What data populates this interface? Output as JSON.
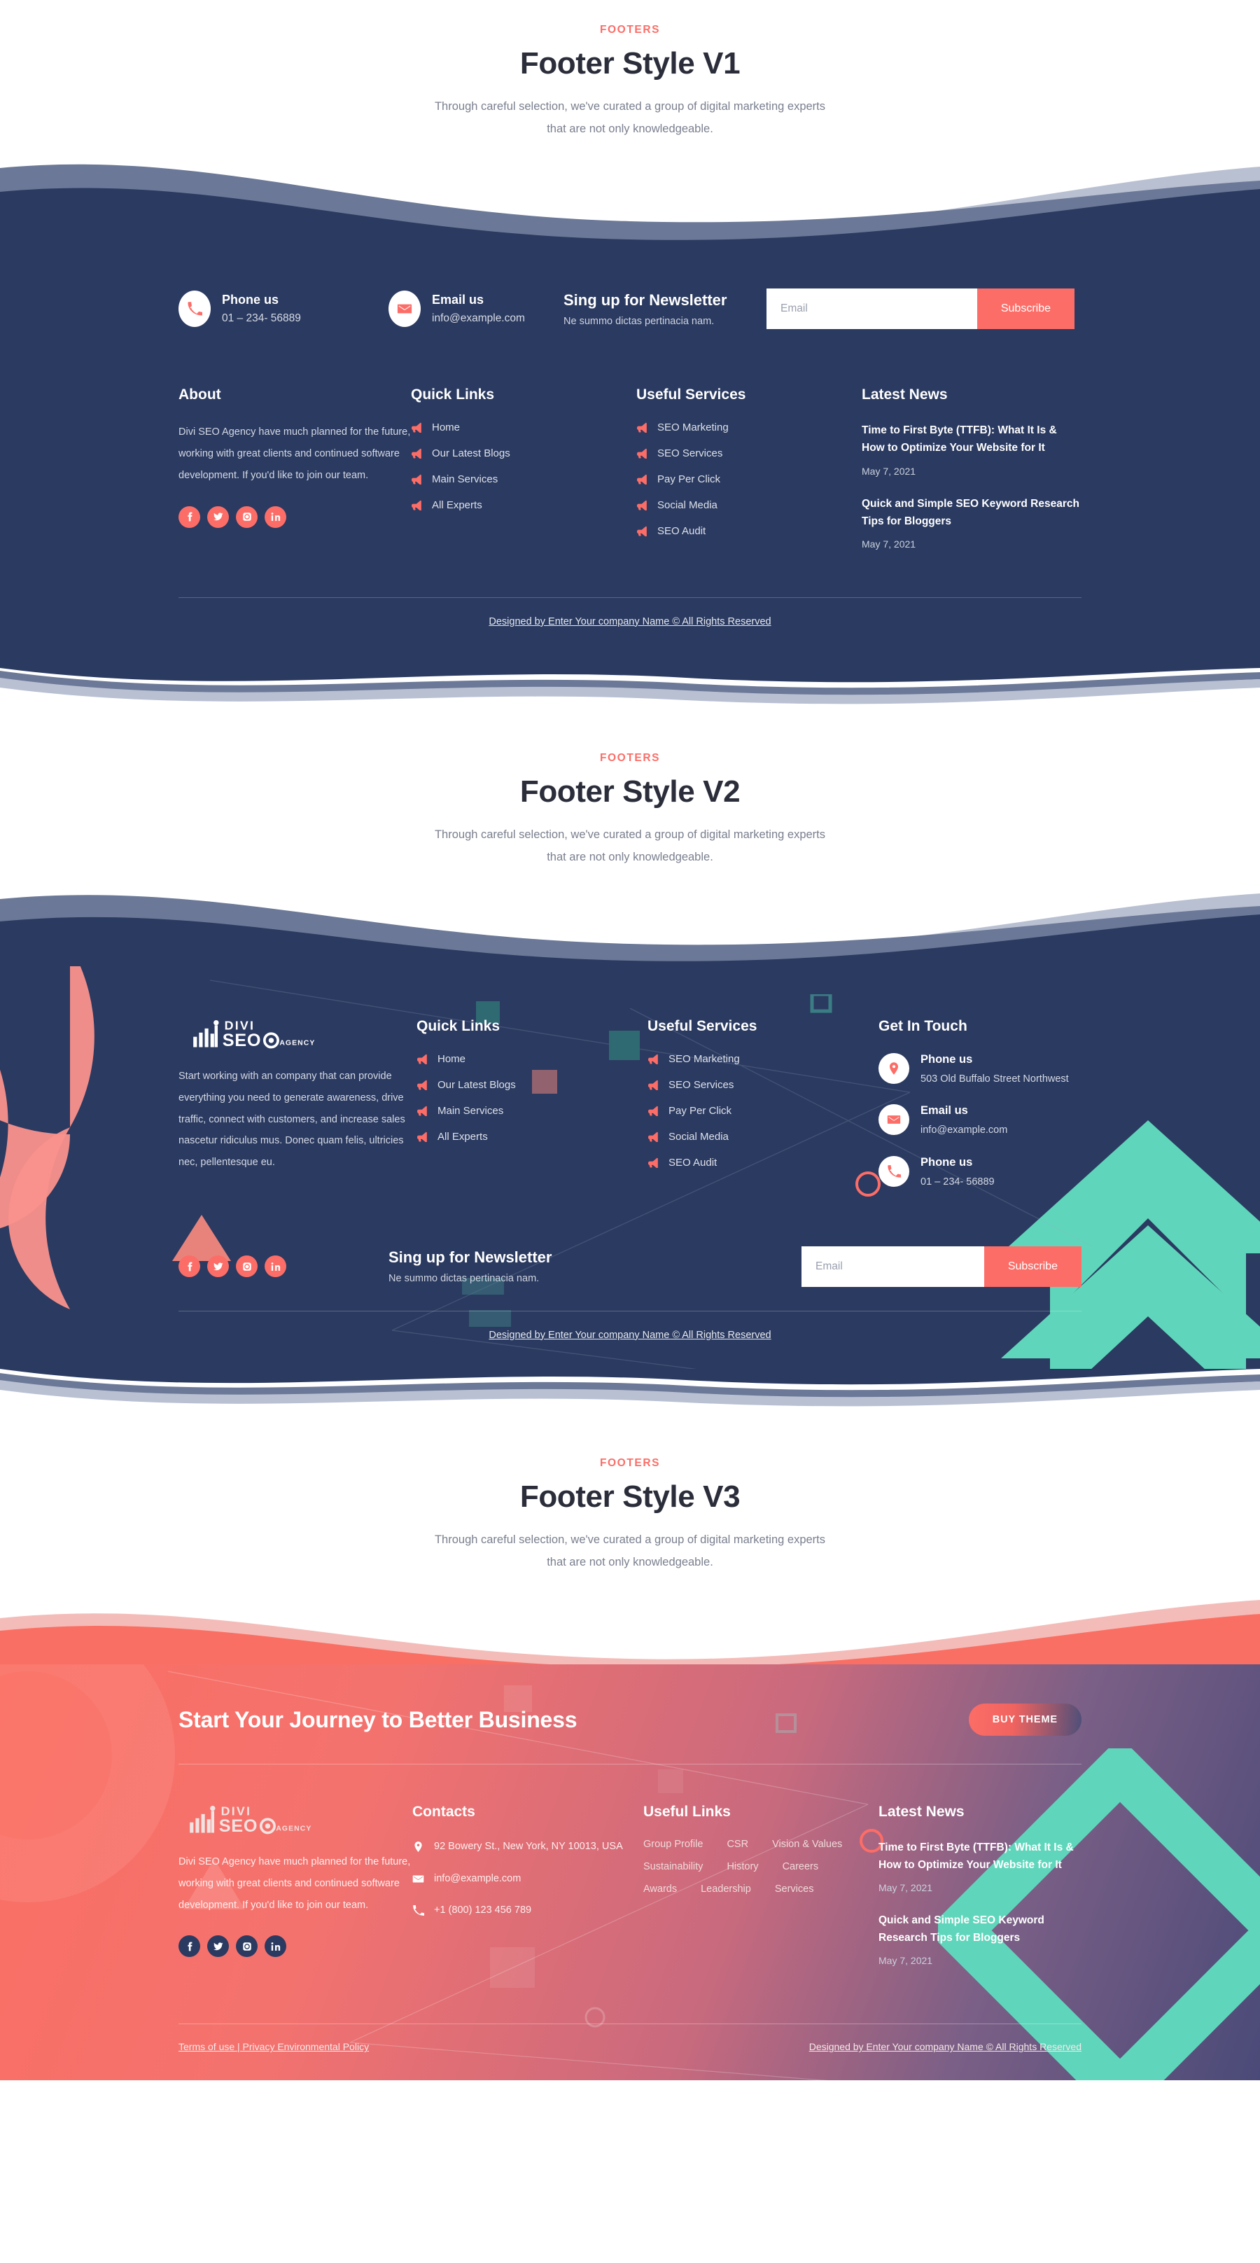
{
  "sections": [
    {
      "eyebrow": "FOOTERS",
      "title": "Footer Style V1",
      "subtitle": "Through careful selection, we've curated a group of digital marketing experts that are not only knowledgeable."
    },
    {
      "eyebrow": "FOOTERS",
      "title": "Footer Style V2",
      "subtitle": "Through careful selection, we've curated a group of digital marketing experts that are not only knowledgeable."
    },
    {
      "eyebrow": "FOOTERS",
      "title": "Footer Style V3",
      "subtitle": "Through careful selection, we've curated a group of digital marketing experts that are not only knowledgeable."
    }
  ],
  "brand": {
    "line1": "DIVI",
    "line2": "SEO",
    "suffix": "AGENCY"
  },
  "colors": {
    "accent": "#fc6d67",
    "navy": "#2b3a60",
    "teal": "#5fd6bb",
    "wave_light": "#b9c0d2",
    "wave_mid": "#6b7897"
  },
  "newsletter": {
    "heading": "Sing up for Newsletter",
    "sub": "Ne summo dictas pertinacia nam.",
    "placeholder": "Email",
    "value": "",
    "button": "Subscribe"
  },
  "v1": {
    "phone": {
      "title": "Phone us",
      "value": "01 – 234- 56889"
    },
    "email": {
      "title": "Email us",
      "value": "info@example.com"
    },
    "about": {
      "heading": "About",
      "text": "Divi SEO Agency have much planned for the future, working with great clients and continued software development. If you'd like to join our team."
    },
    "quick_links": {
      "heading": "Quick Links",
      "items": [
        "Home",
        "Our Latest Blogs",
        "Main Services",
        "All Experts"
      ]
    },
    "useful_services": {
      "heading": "Useful Services",
      "items": [
        "SEO Marketing",
        "SEO Services",
        "Pay Per Click",
        "Social Media",
        "SEO Audit"
      ]
    },
    "latest_news": {
      "heading": "Latest News",
      "items": [
        {
          "title": "Time to First Byte (TTFB): What It Is & How to Optimize Your Website for It",
          "date": "May 7, 2021"
        },
        {
          "title": "Quick and Simple SEO Keyword Research Tips for Bloggers",
          "date": "May 7, 2021"
        }
      ]
    },
    "copyright": "Designed by Enter Your company Name © All Rights Reserved"
  },
  "v2": {
    "about_text": "Start working with an company that can provide everything you need to generate awareness, drive traffic, connect with customers, and increase sales nascetur ridiculus mus. Donec quam felis, ultricies nec, pellentesque eu.",
    "quick_links": {
      "heading": "Quick Links",
      "items": [
        "Home",
        "Our Latest Blogs",
        "Main Services",
        "All Experts"
      ]
    },
    "useful_services": {
      "heading": "Useful Services",
      "items": [
        "SEO Marketing",
        "SEO Services",
        "Pay Per Click",
        "Social Media",
        "SEO Audit"
      ]
    },
    "get_in_touch": {
      "heading": "Get In Touch",
      "items": [
        {
          "icon": "map-pin-icon",
          "title": "Phone us",
          "value": "503 Old Buffalo Street Northwest"
        },
        {
          "icon": "envelope-icon",
          "title": "Email us",
          "value": "info@example.com"
        },
        {
          "icon": "phone-icon",
          "title": "Phone us",
          "value": "01 – 234- 56889"
        }
      ]
    },
    "copyright": "Designed by Enter Your company Name © All Rights Reserved"
  },
  "v3": {
    "hero_title": "Start Your Journey to Better Business",
    "buy_button": "BUY THEME",
    "about_text": "Divi SEO Agency have much planned for the future, working with great clients and continued software development. If you'd like to join our team.",
    "contacts": {
      "heading": "Contacts",
      "items": [
        {
          "icon": "map-pin-icon",
          "value": "92 Bowery St., New York, NY 10013, USA"
        },
        {
          "icon": "envelope-icon",
          "value": "info@example.com"
        },
        {
          "icon": "phone-icon",
          "value": "+1 (800) 123 456 789"
        }
      ]
    },
    "useful_links": {
      "heading": "Useful Links",
      "items": [
        "Group Profile",
        "CSR",
        "Vision & Values",
        "Sustainability",
        "History",
        "Careers",
        "Awards",
        "Leadership",
        "Services"
      ]
    },
    "latest_news": {
      "heading": "Latest News",
      "items": [
        {
          "title": "Time to First Byte (TTFB): What It Is & How to Optimize Your Website for It",
          "date": "May 7, 2021"
        },
        {
          "title": "Quick and Simple SEO Keyword Research Tips for Bloggers",
          "date": "May 7, 2021"
        }
      ]
    },
    "terms": "Terms of use | Privacy Environmental Policy",
    "copyright": "Designed by Enter Your company Name © All Rights Reserved"
  },
  "social": [
    {
      "name": "facebook-icon",
      "glyph": "f"
    },
    {
      "name": "twitter-icon",
      "glyph": "t"
    },
    {
      "name": "instagram-icon",
      "glyph": "i"
    },
    {
      "name": "linkedin-icon",
      "glyph": "in"
    }
  ]
}
